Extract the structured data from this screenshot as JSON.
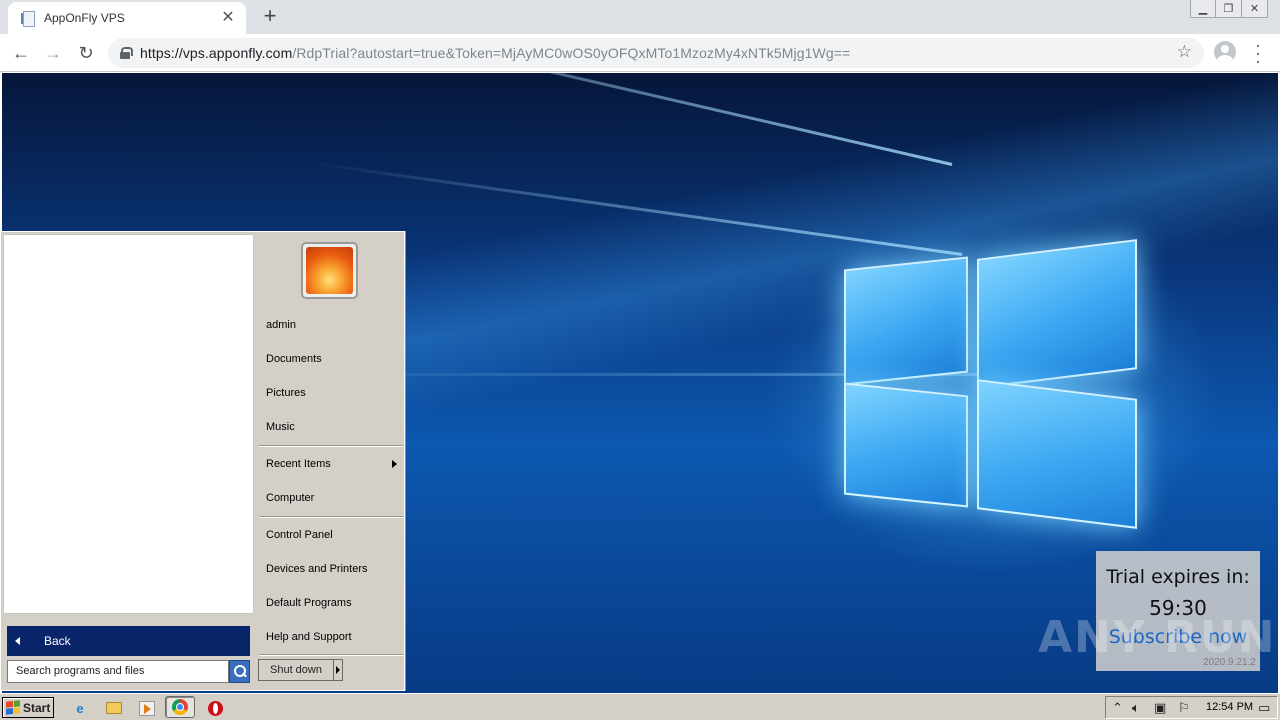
{
  "browser": {
    "tab_title": "AppOnFly VPS",
    "url_host": "https://vps.apponfly.com",
    "url_rest": "/RdpTrial?autostart=true&Token=MjAyMC0wOS0yOFQxMTo1MzozMy4xNTk5Mjg1Wg=="
  },
  "start_menu": {
    "user_items": [
      {
        "label": "admin"
      },
      {
        "label": "Documents"
      },
      {
        "label": "Pictures"
      },
      {
        "label": "Music"
      }
    ],
    "middle_items": [
      {
        "label": "Recent Items"
      },
      {
        "label": "Computer"
      }
    ],
    "system_items": [
      {
        "label": "Control Panel"
      },
      {
        "label": "Devices and Printers"
      },
      {
        "label": "Default Programs"
      },
      {
        "label": "Help and Support"
      }
    ],
    "back_label": "Back",
    "search_placeholder": "Search programs and files",
    "shutdown_label": "Shut down"
  },
  "trial": {
    "title": "Trial expires in:",
    "timer": "59:30",
    "subscribe": "Subscribe now"
  },
  "watermark": "ANY RUN",
  "version": "2020.9.21.2",
  "taskbar": {
    "start_label": "Start",
    "clock": "12:54 PM",
    "icons": [
      "internet-explorer-icon",
      "folder-icon",
      "media-player-icon",
      "chrome-icon",
      "opera-icon"
    ]
  },
  "colors": {
    "start_menu_bg": "#d4d0c8",
    "back_bar": "#0a246a",
    "subscribe_link": "#1a66c4"
  }
}
